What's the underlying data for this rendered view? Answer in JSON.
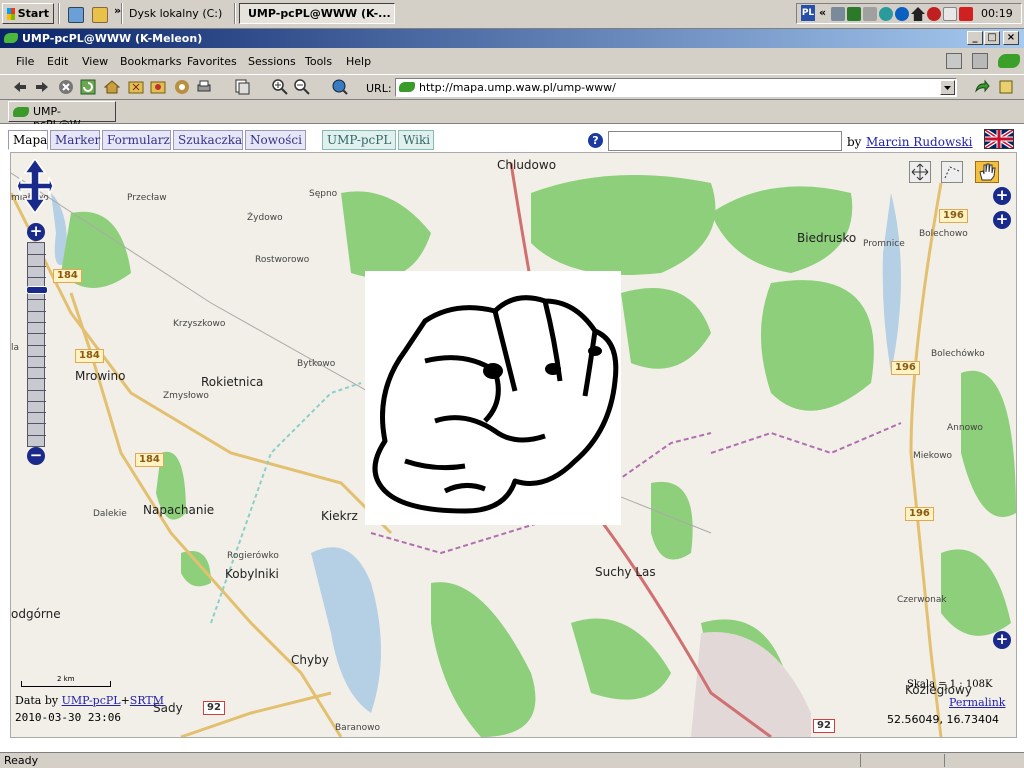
{
  "taskbar": {
    "start_label": "Start",
    "more_glyph": "»",
    "disk_label": "Dysk lokalny (C:)",
    "window_label": "UMP-pcPL@WWW (K-...",
    "tray": {
      "lang": "PL",
      "chevron": "«",
      "clock": "00:19"
    }
  },
  "window": {
    "title": "UMP-pcPL@WWW (K-Meleon)",
    "btn_min": "_",
    "btn_max": "□",
    "btn_close": "×"
  },
  "menubar": {
    "items": [
      "File",
      "Edit",
      "View",
      "Bookmarks",
      "Favorites",
      "Sessions",
      "Tools",
      "Help"
    ]
  },
  "toolbar": {
    "url_label": "URL:",
    "url": "http://mapa.ump.waw.pl/ump-www/"
  },
  "browser_tab": {
    "label": "UMP-pcPL@W..."
  },
  "page": {
    "tabs": [
      "Mapa",
      "Marker",
      "Formularz",
      "Szukaczka",
      "Nowości"
    ],
    "tabs_green": [
      "UMP-pcPL",
      "Wiki"
    ],
    "help_glyph": "?",
    "search_value": "",
    "by_label": "by",
    "author": "Marcin Rudowski"
  },
  "map": {
    "places_big": [
      "Chludowo",
      "Biedrusko",
      "Mrowino",
      "Rokietnica",
      "Napachanie",
      "Kiekrz",
      "Suchy Las",
      "Kobylniki",
      "Chyby",
      "odgórne",
      "Sady",
      "Koziegłowy"
    ],
    "places_small": [
      "Przecław",
      "Sępno",
      "Żydowo",
      "Rostworowo",
      "Krzyszkowo",
      "Bytkowo",
      "Zmysłowo",
      "Dalekie",
      "Rogierówko",
      "Promnice",
      "Bolechowo",
      "Bolechówko",
      "Annowo",
      "Miekowo",
      "Czerwonak",
      "Baranowo",
      "miałowo",
      "la"
    ],
    "road_shields": [
      "184",
      "184",
      "184",
      "196",
      "196",
      "196",
      "92",
      "92"
    ],
    "scale_bar_label": "2 km",
    "data_by": "Data by",
    "data_src1": "UMP-pcPL",
    "data_plus": "+",
    "data_src2": "SRTM",
    "datetime": "2010-03-30 23:06",
    "scale": "Skala = 1 : 108K",
    "permalink": "Permalink",
    "coords": "52.56049, 16.73404",
    "zoom_level_fraction": 0.22
  },
  "statusbar": {
    "text": "Ready"
  },
  "colors": {
    "titlebar_start": "#0a246a",
    "titlebar_end": "#a6caf0",
    "forest": "#8dcf7a",
    "water": "#b5cfe5",
    "link": "#2222aa"
  }
}
